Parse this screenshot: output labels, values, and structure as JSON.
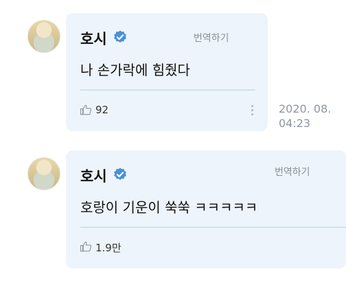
{
  "posts": [
    {
      "author": "호시",
      "translate_label": "번역하기",
      "message": "나 손가락에 힘줬다",
      "likes": "92",
      "timestamp_date": "2020. 08.",
      "timestamp_time": "04:23"
    },
    {
      "author": "호시",
      "translate_label": "번역하기",
      "message": "호랑이 기운이 쑥쑥 ㅋㅋㅋㅋㅋ",
      "likes": "1.9만"
    }
  ],
  "colors": {
    "card_bg": "#eef4fb",
    "verified_badge": "#4a90d9",
    "divider": "#cfe3ee"
  }
}
